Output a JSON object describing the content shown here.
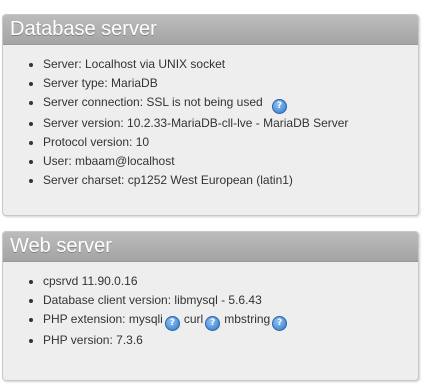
{
  "db_server": {
    "title": "Database server",
    "items": [
      "Server: Localhost via UNIX socket",
      "Server type: MariaDB",
      "Server connection: SSL is not being used",
      "Server version: 10.2.33-MariaDB-cll-lve - MariaDB Server",
      "Protocol version: 10",
      "User: mbaam@localhost",
      "Server charset: cp1252 West European (latin1)"
    ]
  },
  "web_server": {
    "title": "Web server",
    "cpsrvd": "cpsrvd 11.90.0.16",
    "db_client": "Database client version: libmysql - 5.6.43",
    "php_ext_label": "PHP extension:",
    "php_extensions": [
      "mysqli",
      "curl",
      "mbstring"
    ],
    "php_version": "PHP version: 7.3.6"
  },
  "icons": {
    "help": "?"
  },
  "colors": {
    "header_bg": "#a9a9a9",
    "panel_bg": "#eeeeee",
    "help_icon": "#2f78c9"
  }
}
